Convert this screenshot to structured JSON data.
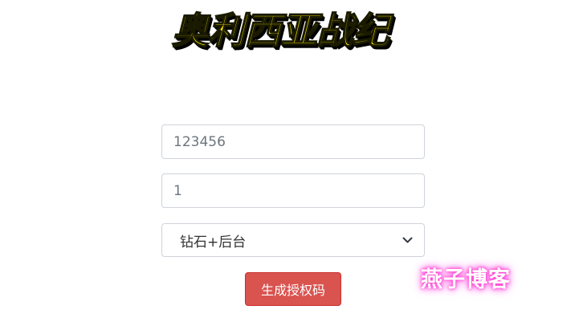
{
  "logo": {
    "title": "奥利西亚战纪"
  },
  "form": {
    "field_1": {
      "value": "123456",
      "placeholder": "123456"
    },
    "field_2": {
      "value": "1",
      "placeholder": "1"
    },
    "select": {
      "selected": "钻石+后台"
    },
    "generate_button_label": "生成授权码"
  },
  "watermark": {
    "text": "燕子博客"
  },
  "colors": {
    "button_bg": "#d9534f",
    "logo_fill": "#ffea00",
    "watermark_glow": "#ff3fd2"
  }
}
